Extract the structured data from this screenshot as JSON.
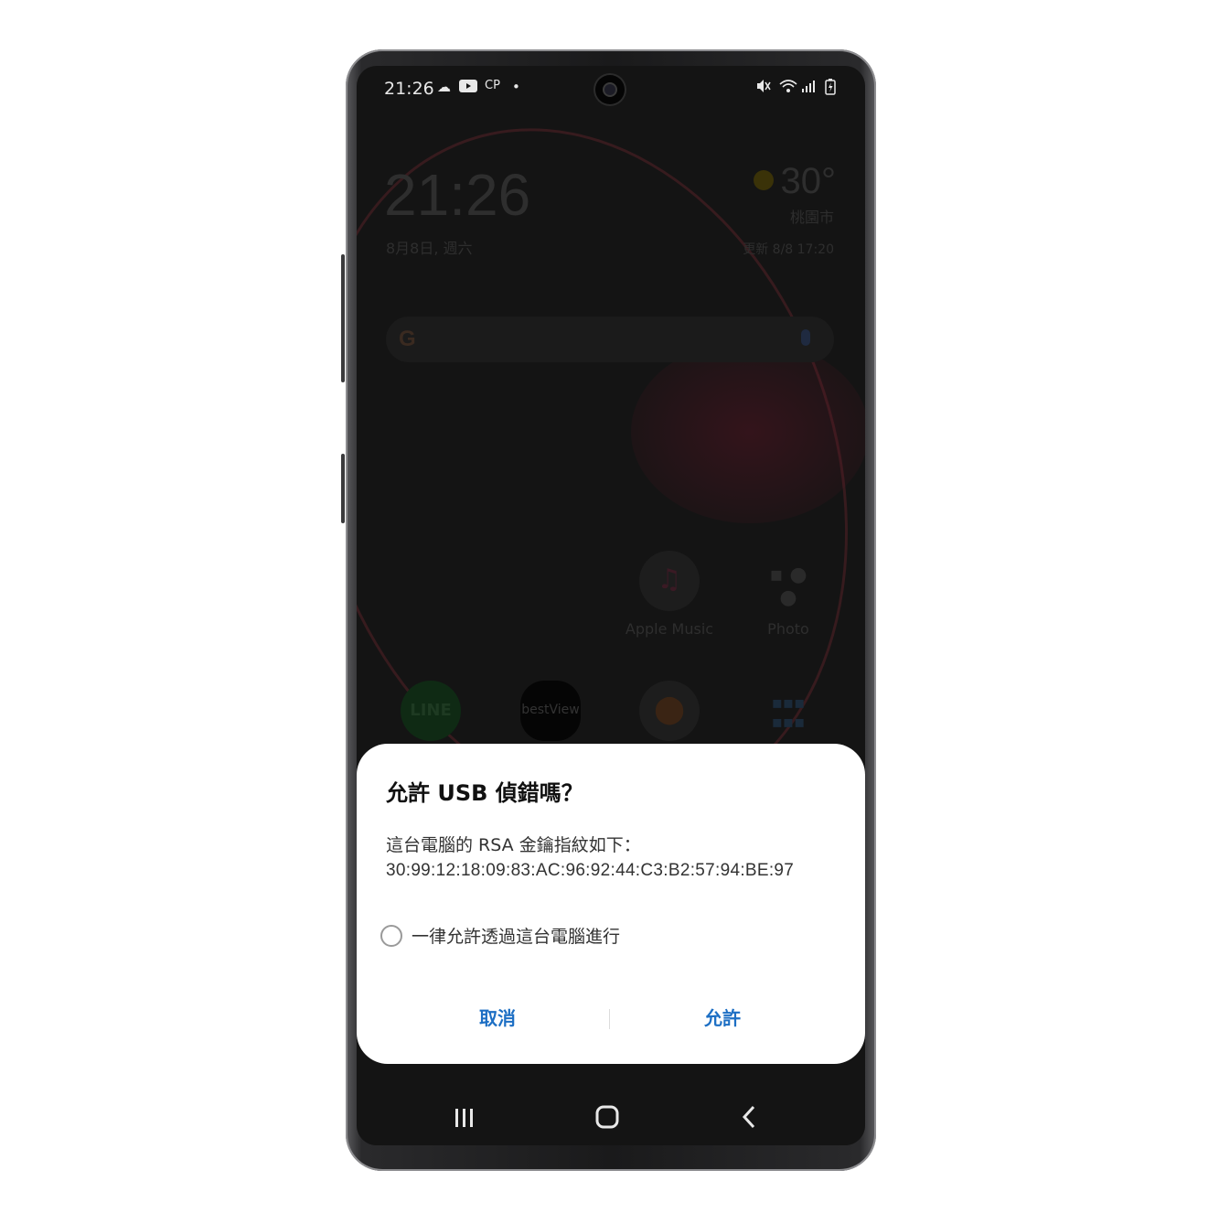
{
  "status_bar": {
    "time": "21:26",
    "left_icons": [
      "cloud-icon",
      "youtube-icon",
      "cp-icon",
      "dot-icon"
    ],
    "right_icons": [
      "mute-icon",
      "wifi-icon",
      "signal-icon",
      "battery-icon"
    ]
  },
  "home": {
    "clock": "21:26",
    "date": "8月8日, 週六",
    "weather": {
      "temp": "30°",
      "city": "桃園市",
      "updated": "更新 8/8 17:20"
    },
    "apps_row1": [
      {
        "label": "Apple Music",
        "icon": "apple-music-icon"
      },
      {
        "label": "Photo",
        "icon": "photo-folder-icon"
      }
    ],
    "apps_row2": [
      {
        "label": "LINE",
        "icon": "line-icon"
      },
      {
        "label": "bestView",
        "icon": "bestview-icon"
      },
      {
        "label": "",
        "icon": "google-maps-icon"
      },
      {
        "label": "",
        "icon": "social-folder-icon"
      }
    ]
  },
  "dialog": {
    "title": "允許 USB 偵錯嗎？",
    "message_line1": "這台電腦的 RSA 金鑰指紋如下：",
    "message_line2": "30:99:12:18:09:83:AC:96:92:44:C3:B2:57:94:BE:97",
    "checkbox_label": "一律允許透過這台電腦進行",
    "checkbox_checked": false,
    "cancel_label": "取消",
    "allow_label": "允許",
    "accent_color": "#1d6fc4"
  },
  "nav_bar": {
    "recents": "recents-icon",
    "home": "home-icon",
    "back": "back-icon"
  }
}
